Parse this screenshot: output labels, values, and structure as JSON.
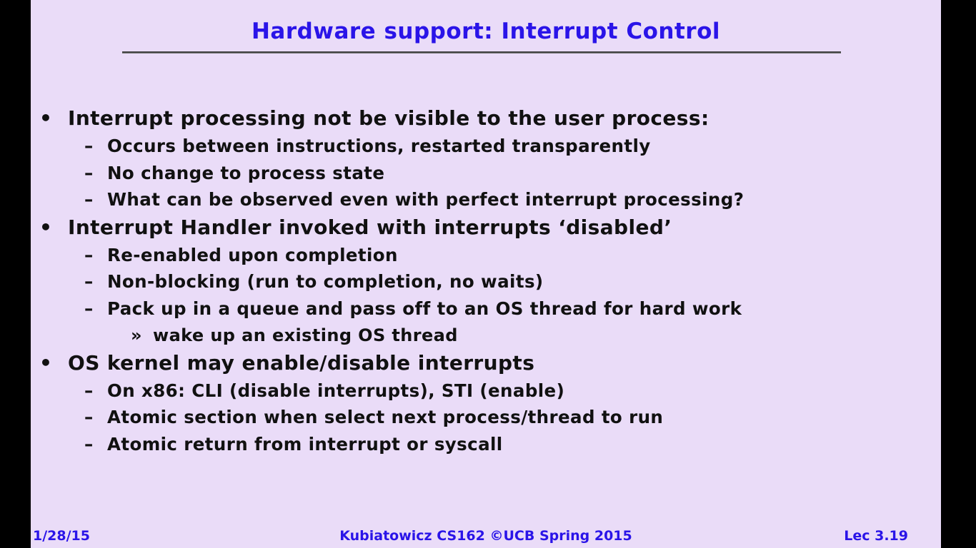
{
  "slide": {
    "title": "Hardware support: Interrupt Control",
    "bullets": [
      {
        "text": "Interrupt processing not be visible to the user process:",
        "subs": [
          {
            "text": "Occurs between instructions, restarted transparently"
          },
          {
            "text": "No change to process state"
          },
          {
            "text": "What can be observed even with perfect interrupt processing?"
          }
        ]
      },
      {
        "text": "Interrupt Handler invoked with interrupts ‘disabled’",
        "subs": [
          {
            "text": "Re-enabled upon completion"
          },
          {
            "text": "Non-blocking (run to completion, no waits)"
          },
          {
            "text": "Pack up in a queue and pass off to an OS thread for hard work",
            "subs": [
              "wake up an existing OS thread"
            ]
          }
        ]
      },
      {
        "text": "OS kernel may enable/disable interrupts",
        "subs": [
          {
            "text": "On x86: CLI (disable interrupts), STI (enable)"
          },
          {
            "text": "Atomic section when select next process/thread to run"
          },
          {
            "text": "Atomic return from interrupt or syscall"
          }
        ]
      }
    ],
    "markers": {
      "level1": "•",
      "level2": "–",
      "level3": "»"
    },
    "footer": {
      "date": "1/28/15",
      "center": "Kubiatowicz CS162 ©UCB Spring 2015",
      "page": "Lec 3.19"
    },
    "colors": {
      "background": "#eadcf8",
      "title": "#2a14e8",
      "body_text": "#111111",
      "frame": "#000000"
    }
  }
}
